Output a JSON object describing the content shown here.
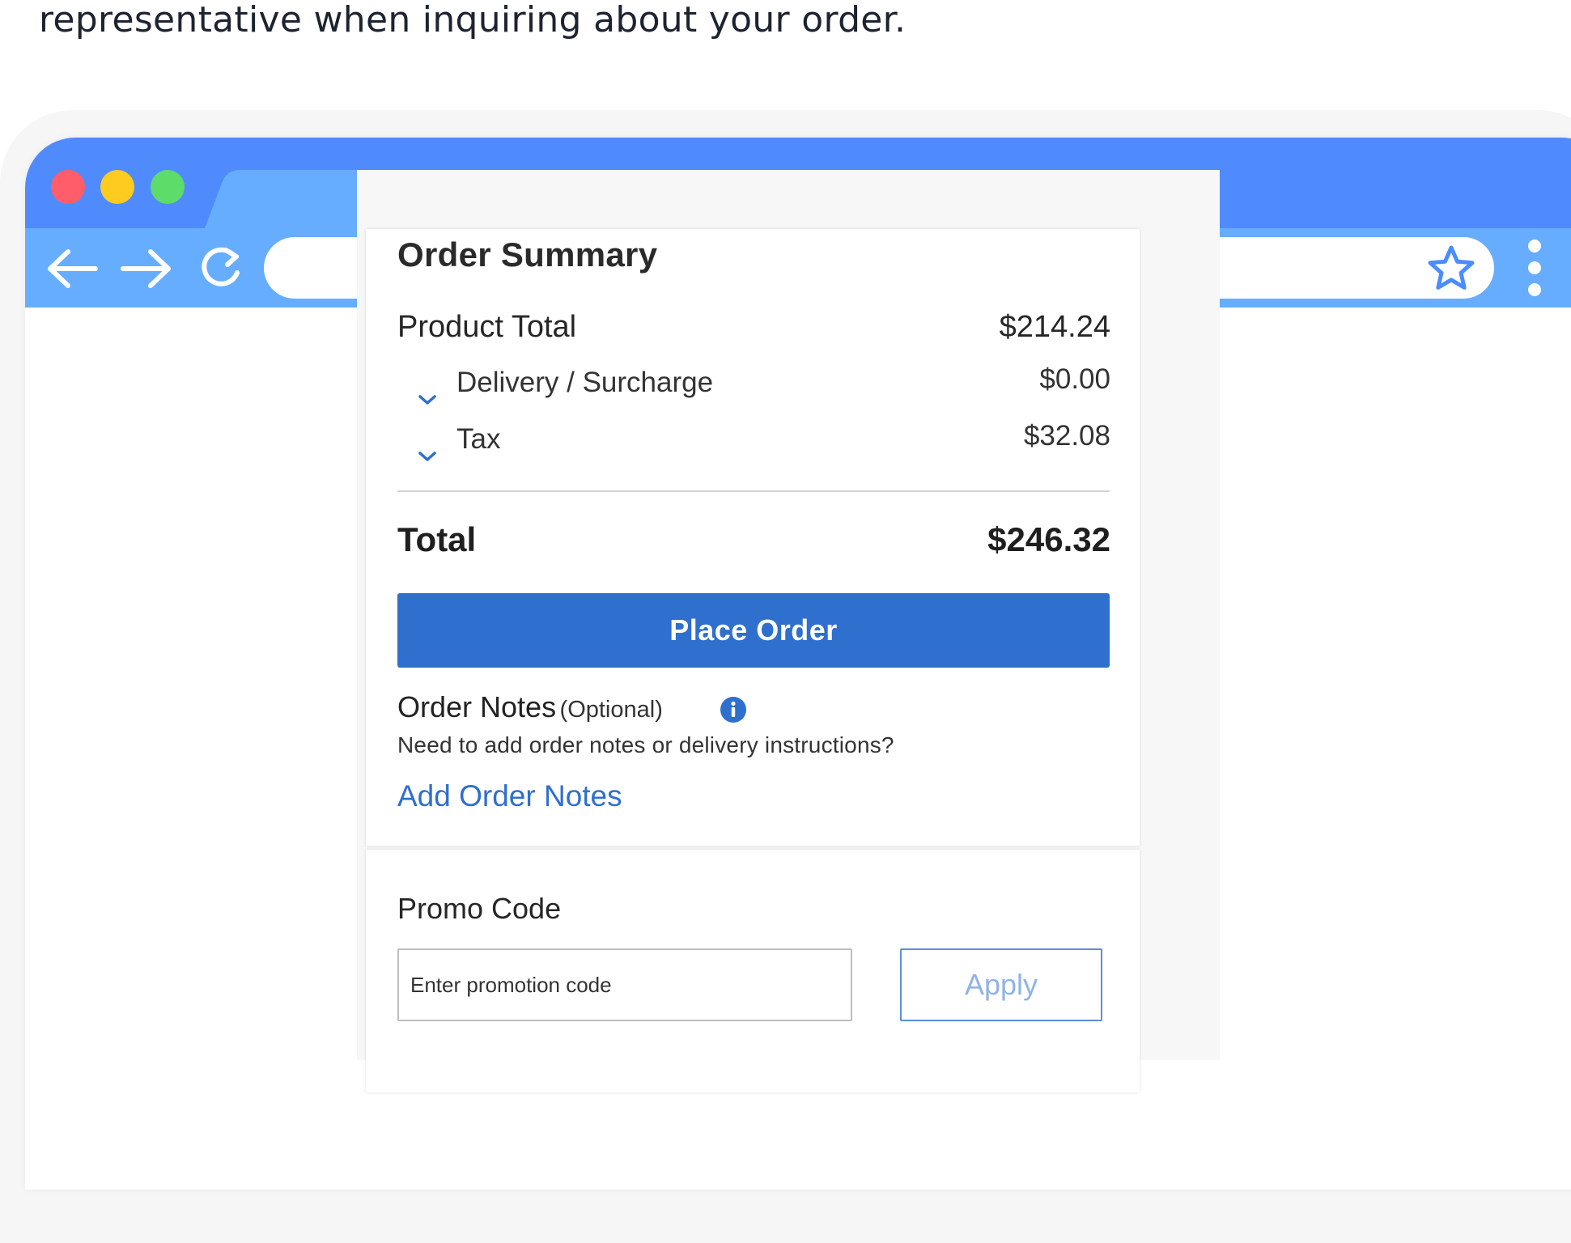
{
  "intro_text": "representative when inquiring about your order.",
  "browser": {
    "address_value": "",
    "icons": {
      "back": "arrow-left-icon",
      "forward": "arrow-right-icon",
      "reload": "reload-icon",
      "bookmark": "star-icon",
      "menu": "kebab-menu-icon"
    },
    "colors": {
      "titlebar": "#508bfd",
      "toolbar": "#67adff",
      "close": "#ff5d6a",
      "minimize": "#fecb1f",
      "maximize": "#5ddc6a"
    }
  },
  "summary": {
    "title": "Order Summary",
    "product_total_label": "Product Total",
    "product_total_value": "$214.24",
    "delivery_label": "Delivery / Surcharge",
    "delivery_value": "$0.00",
    "tax_label": "Tax",
    "tax_value": "$32.08",
    "total_label": "Total",
    "total_value": "$246.32",
    "place_order_label": "Place Order",
    "accent_color": "#2f6fcd"
  },
  "notes": {
    "title": "Order Notes",
    "optional": "(Optional)",
    "description": "Need to add order notes or delivery instructions?",
    "add_link": "Add Order Notes"
  },
  "promo": {
    "title": "Promo Code",
    "placeholder": "Enter promotion code",
    "value": "",
    "apply_label": "Apply"
  }
}
